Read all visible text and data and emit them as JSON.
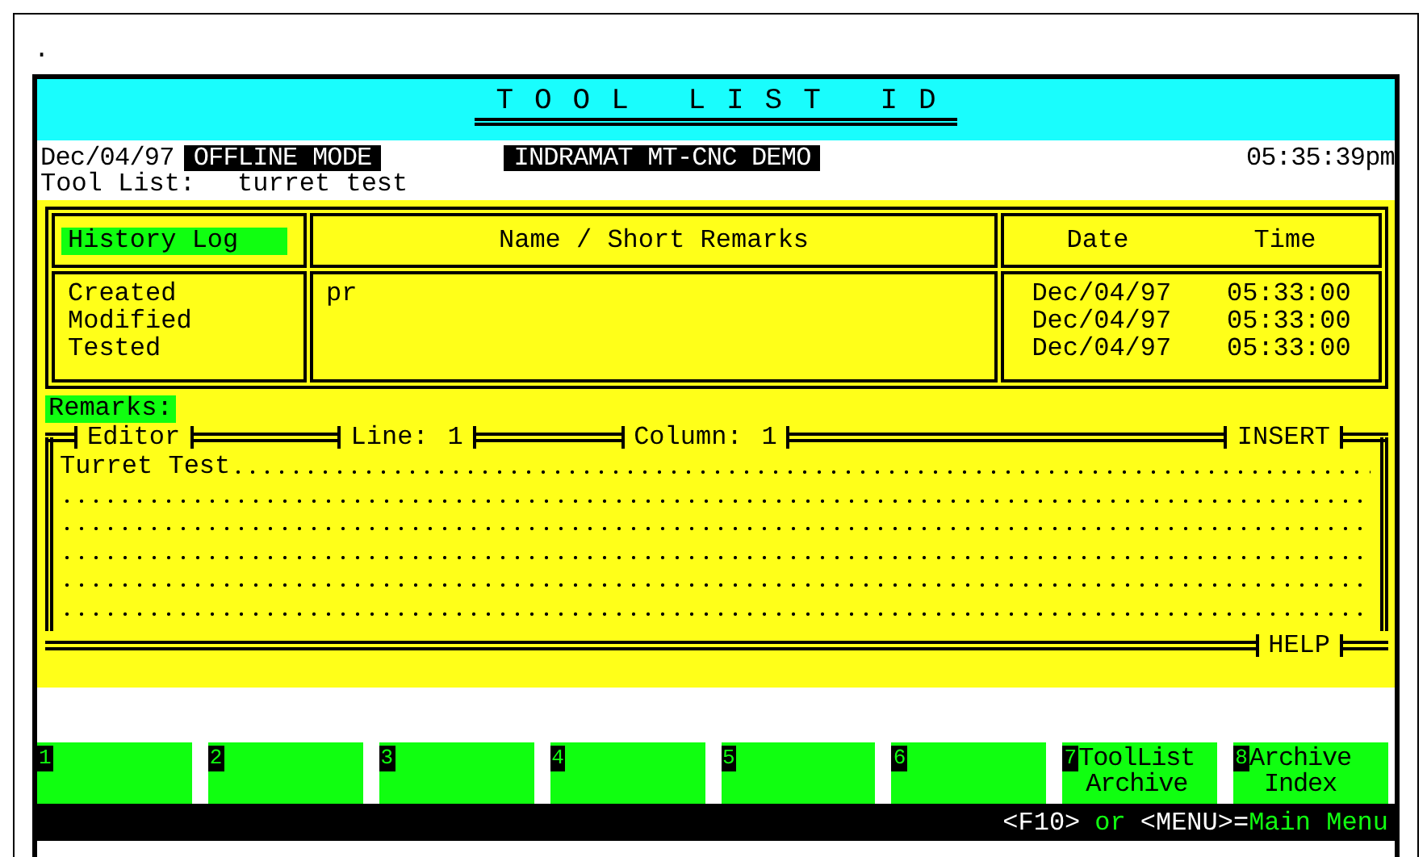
{
  "corner_mark": ".",
  "title": "TOOL LIST ID",
  "status": {
    "date": "Dec/04/97",
    "mode": "OFFLINE MODE",
    "system": "INDRAMAT MT-CNC DEMO",
    "time": "05:35:39pm"
  },
  "tool_list": {
    "label": "Tool List:",
    "value": "turret test"
  },
  "history": {
    "heading": "History Log",
    "columns": [
      "Name / Short Remarks",
      "Date",
      "Time"
    ],
    "rows": [
      {
        "event": "Created",
        "name": "pr",
        "date": "Dec/04/97",
        "time": "05:33:00"
      },
      {
        "event": "Modified",
        "date": "Dec/04/97",
        "time": "05:33:00"
      },
      {
        "event": "Tested",
        "date": "Dec/04/97",
        "time": "05:33:00"
      }
    ]
  },
  "remarks": {
    "label": "Remarks:",
    "editor": "Editor",
    "line_label": "Line:",
    "line": "1",
    "column_label": "Column:",
    "column": "1",
    "mode": "INSERT",
    "help": "HELP",
    "text_lines": [
      "Turret Test"
    ]
  },
  "function_keys": [
    {
      "number": "1"
    },
    {
      "number": "2"
    },
    {
      "number": "3"
    },
    {
      "number": "4"
    },
    {
      "number": "5"
    },
    {
      "number": "6"
    },
    {
      "number": "7",
      "label": [
        "ToolList",
        "Archive"
      ]
    },
    {
      "number": "8",
      "label": [
        "Archive",
        "Index"
      ]
    }
  ],
  "footer": {
    "parts": [
      {
        "kind": "key",
        "text": "<F10>"
      },
      {
        "kind": "word",
        "text": "or"
      },
      {
        "kind": "key",
        "text": "<MENU>="
      },
      {
        "kind": "word",
        "text": "Main Menu"
      }
    ]
  }
}
